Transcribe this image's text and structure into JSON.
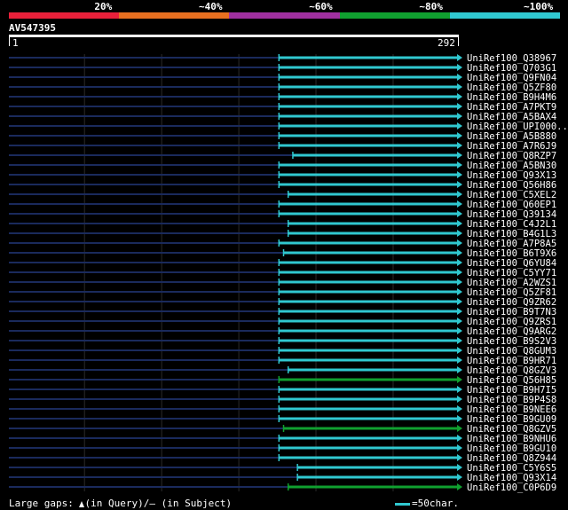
{
  "identity_legend": [
    {
      "label": "20%",
      "color": "#e8203a"
    },
    {
      "label": "~40%",
      "color": "#e87020"
    },
    {
      "label": "~60%",
      "color": "#a030a0"
    },
    {
      "label": "~80%",
      "color": "#10a030"
    },
    {
      "label": "~100%",
      "color": "#30c8d0"
    }
  ],
  "query": {
    "name": "AV547395",
    "start": "1",
    "end": "292"
  },
  "footer": {
    "gaps_prefix": "Large gaps:",
    "gaps_query": "(in Query)/",
    "gaps_dash": "–",
    "gaps_subject": "(in Subject)",
    "scale_label": "=50char."
  },
  "chart_data": {
    "type": "alignment-overview",
    "query_length": 292,
    "x_range": [
      1,
      292
    ],
    "grid": true,
    "hits": [
      {
        "name": "UniRef100_Q38967",
        "start": 176,
        "end": 292,
        "color": "#30c8d0"
      },
      {
        "name": "UniRef100_Q703G1",
        "start": 176,
        "end": 292,
        "color": "#30c8d0"
      },
      {
        "name": "UniRef100_Q9FN04",
        "start": 176,
        "end": 292,
        "color": "#30c8d0"
      },
      {
        "name": "UniRef100_Q5ZF80",
        "start": 176,
        "end": 292,
        "color": "#30c8d0"
      },
      {
        "name": "UniRef100_B9H4M6",
        "start": 176,
        "end": 292,
        "color": "#30c8d0"
      },
      {
        "name": "UniRef100_A7PKT9",
        "start": 176,
        "end": 292,
        "color": "#30c8d0"
      },
      {
        "name": "UniRef100_A5BAX4",
        "start": 176,
        "end": 292,
        "color": "#30c8d0"
      },
      {
        "name": "UniRef100_UPI000..",
        "start": 176,
        "end": 292,
        "color": "#30c8d0"
      },
      {
        "name": "UniRef100_A5B880",
        "start": 176,
        "end": 292,
        "color": "#30c8d0"
      },
      {
        "name": "UniRef100_A7R6J9",
        "start": 176,
        "end": 292,
        "color": "#30c8d0"
      },
      {
        "name": "UniRef100_Q8RZP7",
        "start": 185,
        "end": 292,
        "color": "#30c8d0"
      },
      {
        "name": "UniRef100_A5BN30",
        "start": 176,
        "end": 292,
        "color": "#30c8d0"
      },
      {
        "name": "UniRef100_Q93X13",
        "start": 176,
        "end": 292,
        "color": "#30c8d0"
      },
      {
        "name": "UniRef100_Q56H86",
        "start": 176,
        "end": 292,
        "color": "#30c8d0"
      },
      {
        "name": "UniRef100_C5XEL2",
        "start": 182,
        "end": 292,
        "color": "#30c8d0"
      },
      {
        "name": "UniRef100_Q60EP1",
        "start": 176,
        "end": 292,
        "color": "#30c8d0"
      },
      {
        "name": "UniRef100_Q39134",
        "start": 176,
        "end": 292,
        "color": "#30c8d0"
      },
      {
        "name": "UniRef100_C4J2L1",
        "start": 182,
        "end": 292,
        "color": "#30c8d0"
      },
      {
        "name": "UniRef100_B4G1L3",
        "start": 182,
        "end": 292,
        "color": "#30c8d0"
      },
      {
        "name": "UniRef100_A7P8A5",
        "start": 176,
        "end": 292,
        "color": "#30c8d0"
      },
      {
        "name": "UniRef100_B6T9X6",
        "start": 179,
        "end": 292,
        "color": "#30c8d0"
      },
      {
        "name": "UniRef100_Q6YU84",
        "start": 176,
        "end": 292,
        "color": "#30c8d0"
      },
      {
        "name": "UniRef100_C5YY71",
        "start": 176,
        "end": 292,
        "color": "#30c8d0"
      },
      {
        "name": "UniRef100_A2WZS1",
        "start": 176,
        "end": 292,
        "color": "#30c8d0"
      },
      {
        "name": "UniRef100_Q5ZF81",
        "start": 176,
        "end": 292,
        "color": "#30c8d0"
      },
      {
        "name": "UniRef100_Q9ZR62",
        "start": 176,
        "end": 292,
        "color": "#30c8d0"
      },
      {
        "name": "UniRef100_B9T7N3",
        "start": 176,
        "end": 292,
        "color": "#30c8d0"
      },
      {
        "name": "UniRef100_Q9ZRS1",
        "start": 176,
        "end": 292,
        "color": "#30c8d0"
      },
      {
        "name": "UniRef100_Q9ARG2",
        "start": 176,
        "end": 292,
        "color": "#30c8d0"
      },
      {
        "name": "UniRef100_B9S2V3",
        "start": 176,
        "end": 292,
        "color": "#30c8d0"
      },
      {
        "name": "UniRef100_Q8GUM3",
        "start": 176,
        "end": 292,
        "color": "#30c8d0"
      },
      {
        "name": "UniRef100_B9HR71",
        "start": 176,
        "end": 292,
        "color": "#30c8d0"
      },
      {
        "name": "UniRef100_Q8GZV3",
        "start": 182,
        "end": 292,
        "color": "#30c8d0"
      },
      {
        "name": "UniRef100_Q56H85",
        "start": 176,
        "end": 292,
        "color": "#10a030"
      },
      {
        "name": "UniRef100_B9H7I5",
        "start": 176,
        "end": 292,
        "color": "#30c8d0"
      },
      {
        "name": "UniRef100_B9P4S8",
        "start": 176,
        "end": 292,
        "color": "#30c8d0"
      },
      {
        "name": "UniRef100_B9NEE6",
        "start": 176,
        "end": 292,
        "color": "#30c8d0"
      },
      {
        "name": "UniRef100_B9GU09",
        "start": 176,
        "end": 292,
        "color": "#30c8d0"
      },
      {
        "name": "UniRef100_Q8GZV5",
        "start": 179,
        "end": 292,
        "color": "#10a030"
      },
      {
        "name": "UniRef100_B9NHU6",
        "start": 176,
        "end": 292,
        "color": "#30c8d0"
      },
      {
        "name": "UniRef100_B9GU10",
        "start": 176,
        "end": 292,
        "color": "#30c8d0"
      },
      {
        "name": "UniRef100_Q8Z944",
        "start": 176,
        "end": 292,
        "color": "#30c8d0"
      },
      {
        "name": "UniRef100_C5Y6S5",
        "start": 188,
        "end": 292,
        "color": "#30c8d0"
      },
      {
        "name": "UniRef100_Q93X14",
        "start": 188,
        "end": 292,
        "color": "#30c8d0"
      },
      {
        "name": "UniRef100_C0P6D9",
        "start": 182,
        "end": 292,
        "color": "#10a030"
      }
    ]
  }
}
